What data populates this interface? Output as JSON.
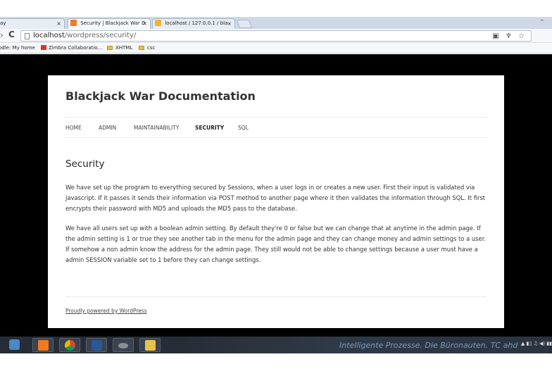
{
  "browser": {
    "tabs": [
      {
        "label": "ay",
        "close": "×"
      },
      {
        "label": "Security | Blackjack War D",
        "close": "×"
      },
      {
        "label": "localhost / 127.0.0.1 / bla",
        "close": "×"
      }
    ],
    "minimize_glyph": "–",
    "reload_glyph": "C",
    "url_host": "localhost",
    "url_path": "/wordpress/security/",
    "toolbar_icons": "▣ ♆ ☆",
    "bookmarks": [
      {
        "label": "odle: My home",
        "icon": "none"
      },
      {
        "label": "Zimbra Collaboratio...",
        "icon": "zimbra-icon"
      },
      {
        "label": "XHTML",
        "icon": "folder-icon"
      },
      {
        "label": "csc",
        "icon": "folder-icon"
      }
    ]
  },
  "site": {
    "title": "Blackjack War Documentation",
    "nav": [
      {
        "label": "HOME",
        "current": false
      },
      {
        "label": "ADMIN",
        "current": false
      },
      {
        "label": "MAINTAINABILITY",
        "current": false
      },
      {
        "label": "SECURITY",
        "current": true
      },
      {
        "label": "SQL",
        "current": false
      }
    ],
    "entry_title": "Security",
    "paragraphs": [
      "We have set up the program to everything secured by Sessions, when a user logs in or creates a new user. First their input is validated via javascript. If it passes it sends their information via POST method to another page where it then validates the information through SQL. It first encrypts their password with MD5 and uploads the MD5 pass to the database.",
      "We have all users set up with a boolean admin setting. By default they're 0 or false but we can change that at anytime in the admin page. If the admin setting is 1 or true they see another tab in the menu for the admin page and they can change money and admin settings to a user. If somehow a non admin know the address for the admin page. They still would not be able to change settings because a user must have a admin SESSION variable set to 1 before they can change settings."
    ],
    "footer": "Proudly powered by WordPress"
  },
  "taskbar": {
    "apps": [
      "virtualbox-icon",
      "xampp-icon",
      "chrome-icon",
      "word-icon",
      "tool-icon",
      "explorer-icon"
    ],
    "brand": "Intelligente Prozesse. Die Büronauten. TC ahd",
    "tray": "▲ ▮▯ ♫ ◀) ▮▮"
  }
}
